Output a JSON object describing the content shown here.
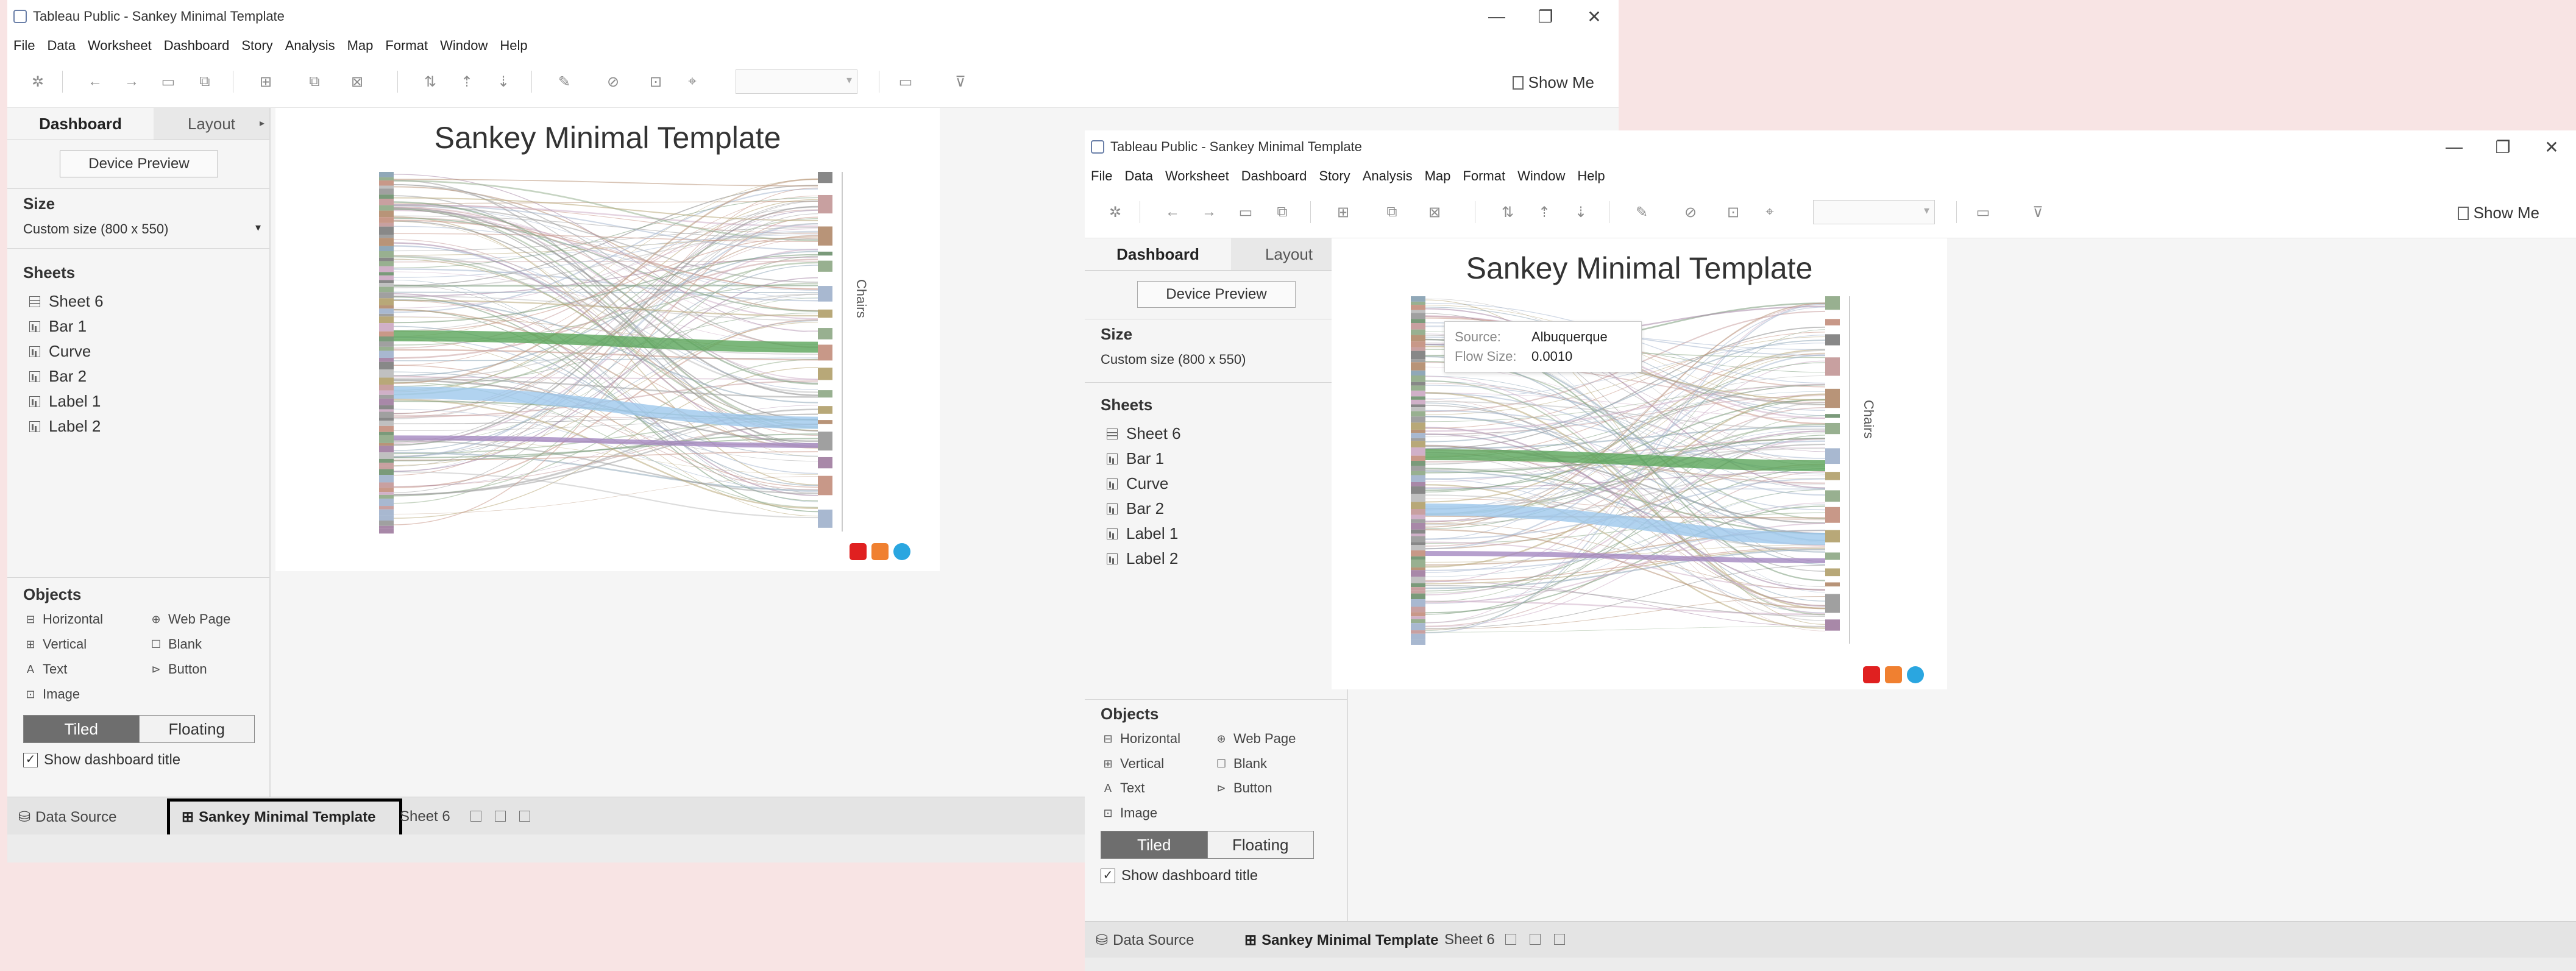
{
  "window": {
    "title": "Tableau Public - Sankey Minimal Template",
    "controls": {
      "minimize": "—",
      "restore": "❐",
      "close": "✕"
    }
  },
  "menu": [
    "File",
    "Data",
    "Worksheet",
    "Dashboard",
    "Story",
    "Analysis",
    "Map",
    "Format",
    "Window",
    "Help"
  ],
  "toolbar": {
    "show_me": "Show Me"
  },
  "panel": {
    "tab_dashboard": "Dashboard",
    "tab_layout": "Layout",
    "device_preview": "Device Preview",
    "size_header": "Size",
    "size_value": "Custom size (800 x 550)",
    "sheets_header": "Sheets",
    "sheets": [
      {
        "name": "Sheet 6",
        "icon": "grid-icon"
      },
      {
        "name": "Bar 1",
        "icon": "bar-chart-icon"
      },
      {
        "name": "Curve",
        "icon": "bar-chart-icon"
      },
      {
        "name": "Bar 2",
        "icon": "bar-chart-icon"
      },
      {
        "name": "Label 1",
        "icon": "bar-chart-icon"
      },
      {
        "name": "Label 2",
        "icon": "bar-chart-icon"
      }
    ],
    "objects_header": "Objects",
    "objects": [
      {
        "name": "Horizontal",
        "icon": "horizontal-container-icon"
      },
      {
        "name": "Vertical",
        "icon": "vertical-container-icon"
      },
      {
        "name": "Text",
        "icon": "text-icon"
      },
      {
        "name": "Image",
        "icon": "image-icon"
      },
      {
        "name": "Web Page",
        "icon": "web-page-icon"
      },
      {
        "name": "Blank",
        "icon": "blank-icon"
      },
      {
        "name": "Button",
        "icon": "button-icon"
      }
    ],
    "tiled": "Tiled",
    "floating": "Floating",
    "show_title": "Show dashboard title",
    "show_title_checked": true
  },
  "dashboard": {
    "title": "Sankey Minimal Template",
    "axis_label": "Chairs",
    "tooltip": {
      "source_label": "Source:",
      "source_value": "Albuquerque",
      "flow_label": "Flow Size:",
      "flow_value": "0.0010"
    },
    "social_icons": [
      "youtube-icon",
      "blog-icon",
      "twitter-icon"
    ],
    "colors": {
      "green": "#5aa55a",
      "blue": "#9ec8ec",
      "purple": "#a488c0",
      "pink": "#f2b8c8",
      "youtube": "#e02020",
      "blog": "#f08030",
      "twitter": "#2aa6e0"
    }
  },
  "statusbar": {
    "data_source": "Data Source",
    "active_tab": "Sankey Minimal Template",
    "sheet_tab": "Sheet 6"
  }
}
